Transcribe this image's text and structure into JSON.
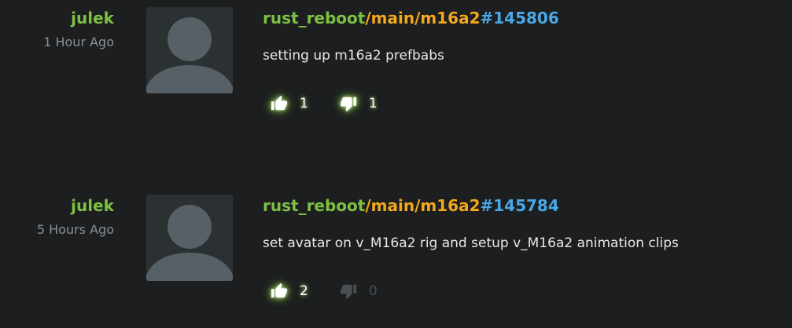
{
  "commits": [
    {
      "author": "julek",
      "time_ago": "1 Hour Ago",
      "repo": "rust_reboot",
      "branch": "/main/m16a2",
      "changeset": "#145806",
      "message": "setting up m16a2 prefbabs",
      "upvotes": "1",
      "downvotes": "1",
      "upvote_icon": "thumbs-up-icon",
      "downvote_icon": "thumbs-down-icon"
    },
    {
      "author": "julek",
      "time_ago": "5 Hours Ago",
      "repo": "rust_reboot",
      "branch": "/main/m16a2",
      "changeset": "#145784",
      "message": "set avatar on v_M16a2 rig and setup v_M16a2 animation clips",
      "upvotes": "2",
      "downvotes": "0",
      "upvote_icon": "thumbs-up-icon",
      "downvote_icon": "thumbs-down-icon"
    }
  ],
  "colors": {
    "background": "#1c1e1f",
    "author": "#7dc143",
    "repo": "#7dc143",
    "branch": "#f2a81d",
    "changeset": "#4aa8e6",
    "time": "#8a8f93",
    "message": "#e8e8e8",
    "avatar_bg": "#2b3032",
    "avatar_fg": "#576066"
  }
}
